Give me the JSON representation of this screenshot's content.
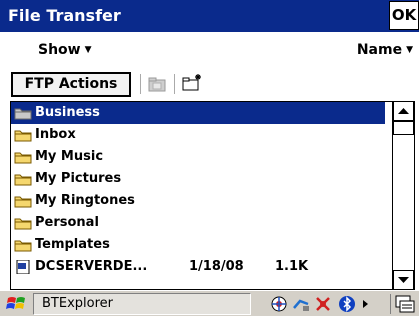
{
  "titlebar": {
    "title": "File Transfer",
    "ok_label": "OK"
  },
  "menubar": {
    "show_label": "Show",
    "name_label": "Name"
  },
  "toolbar": {
    "ftp_actions_label": "FTP Actions"
  },
  "files": [
    {
      "name": "Business",
      "type": "folder-special",
      "date": "",
      "size": "",
      "selected": true
    },
    {
      "name": "Inbox",
      "type": "folder",
      "date": "",
      "size": ""
    },
    {
      "name": "My Music",
      "type": "folder",
      "date": "",
      "size": ""
    },
    {
      "name": "My Pictures",
      "type": "folder",
      "date": "",
      "size": ""
    },
    {
      "name": "My Ringtones",
      "type": "folder",
      "date": "",
      "size": ""
    },
    {
      "name": "Personal",
      "type": "folder",
      "date": "",
      "size": ""
    },
    {
      "name": "Templates",
      "type": "folder",
      "date": "",
      "size": ""
    },
    {
      "name": "DCSERVERDE...",
      "type": "file",
      "date": "1/18/08",
      "size": "1.1K"
    }
  ],
  "taskbar": {
    "active_app": "BTExplorer"
  },
  "colors": {
    "titlebar": "#0a2a8c",
    "selection": "#0a2a8c",
    "taskbar": "#d4d0c8"
  }
}
